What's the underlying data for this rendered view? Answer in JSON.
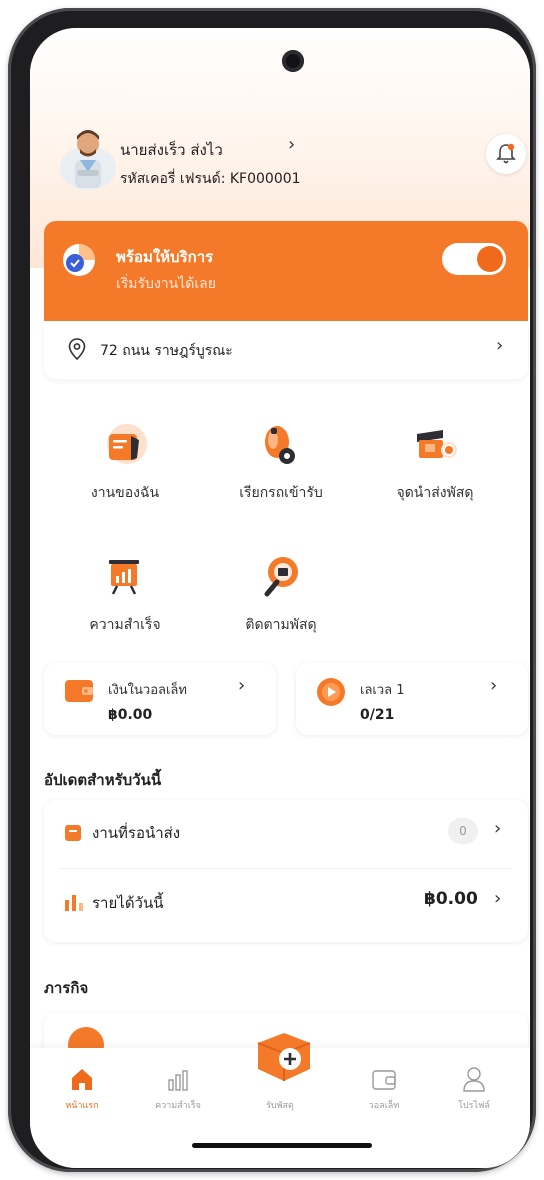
{
  "user": {
    "name": "นายส่งเร็ว ส่งไว",
    "code": "รหัสเคอรี่ เฟรนด์: KF000001"
  },
  "status": {
    "title": "พร้อมให้บริการ",
    "subtitle": "เริ่มรับงานได้เลย",
    "online": true
  },
  "location": {
    "address": "72 ถนน ราษฎร์บูรณะ"
  },
  "menu": [
    {
      "label": "งานของฉัน",
      "icon": "briefcase-icon"
    },
    {
      "label": "เรียกรถเข้ารับ",
      "icon": "call-pickup-icon"
    },
    {
      "label": "จุดนำส่งพัสดุ",
      "icon": "dropoff-point-icon"
    },
    {
      "label": "ความสำเร็จ",
      "icon": "achievement-icon"
    },
    {
      "label": "ติดตามพัสดุ",
      "icon": "track-parcel-icon"
    }
  ],
  "wallet": {
    "title": "เงินในวอลเล็ท",
    "amount": "฿0.00"
  },
  "level": {
    "title": "เลเวล 1",
    "progress": "0/21"
  },
  "updates": {
    "title": "อัปเดตสำหรับวันนี้",
    "pending_label": "งานที่รอนำส่ง",
    "pending_count": "0",
    "income_label": "รายได้วันนี้",
    "income_amount": "฿0.00"
  },
  "missions": {
    "title": "ภารกิจ"
  },
  "nav": [
    {
      "label": "หน้าแรก",
      "icon": "home-icon",
      "active": true
    },
    {
      "label": "ความสำเร็จ",
      "icon": "bar-chart-icon",
      "active": false
    },
    {
      "label": "รับพัสดุ",
      "icon": "receive-parcel-icon",
      "active": false
    },
    {
      "label": "วอลเล็ท",
      "icon": "wallet-icon",
      "active": false
    },
    {
      "label": "โปรไฟล์",
      "icon": "profile-icon",
      "active": false
    }
  ],
  "colors": {
    "accent": "#f47a2a",
    "accent_dark": "#f06a1c"
  }
}
